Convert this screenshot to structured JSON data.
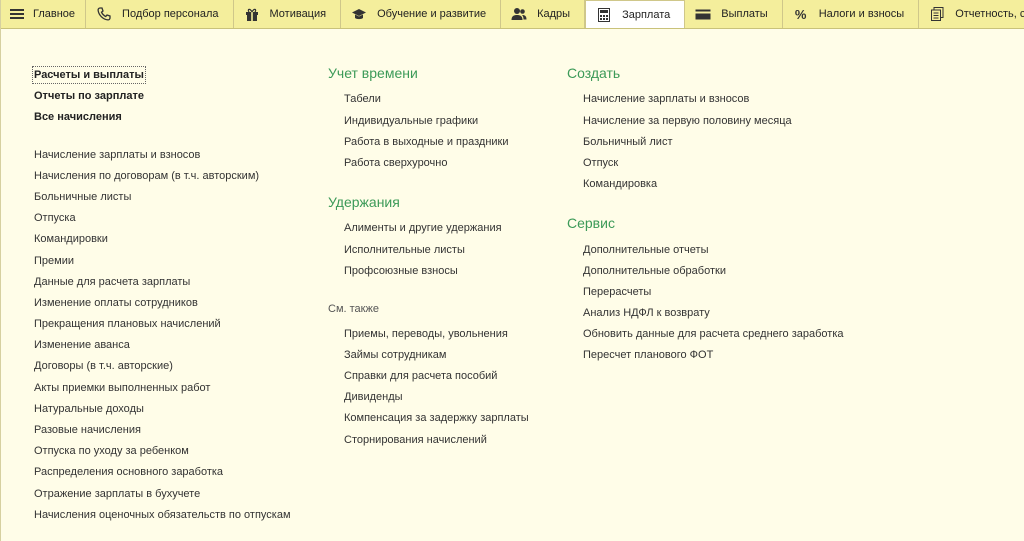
{
  "topbar": {
    "tabs": [
      {
        "label": "Главное",
        "icon": "menu-icon"
      },
      {
        "label": "Подбор персонала",
        "icon": "phone-icon"
      },
      {
        "label": "Мотивация",
        "icon": "gift-icon"
      },
      {
        "label": "Обучение и развитие",
        "icon": "graduation-cap-icon"
      },
      {
        "label": "Кадры",
        "icon": "users-icon"
      },
      {
        "label": "Зарплата",
        "icon": "calculator-icon",
        "active": true
      },
      {
        "label": "Выплаты",
        "icon": "wallet-icon"
      },
      {
        "label": "Налоги и взносы",
        "icon": "percent-icon"
      },
      {
        "label": "Отчетность, справки",
        "icon": "documents-icon"
      }
    ]
  },
  "left": {
    "top_links": [
      "Расчеты и выплаты",
      "Отчеты по зарплате",
      "Все начисления"
    ],
    "links": [
      "Начисление зарплаты и взносов",
      "Начисления по договорам (в т.ч. авторским)",
      "Больничные листы",
      "Отпуска",
      "Командировки",
      "Премии",
      "Данные для расчета зарплаты",
      "Изменение оплаты сотрудников",
      "Прекращения плановых начислений",
      "Изменение аванса",
      "Договоры (в т.ч. авторские)",
      "Акты приемки выполненных работ",
      "Натуральные доходы",
      "Разовые начисления",
      "Отпуска по уходу за ребенком",
      "Распределения основного заработка",
      "Отражение зарплаты в бухучете",
      "Начисления оценочных обязательств по отпускам"
    ]
  },
  "middle": {
    "time": {
      "title": "Учет времени",
      "items": [
        "Табели",
        "Индивидуальные графики",
        "Работа в выходные и праздники",
        "Работа сверхурочно"
      ]
    },
    "deductions": {
      "title": "Удержания",
      "items": [
        "Алименты и другие удержания",
        "Исполнительные листы",
        "Профсоюзные взносы"
      ]
    },
    "see_also": {
      "title": "См. также",
      "items": [
        "Приемы, переводы, увольнения",
        "Займы сотрудникам",
        "Справки для расчета пособий",
        "Дивиденды",
        "Компенсация за задержку зарплаты",
        "Сторнирования начислений"
      ]
    }
  },
  "right": {
    "create": {
      "title": "Создать",
      "items": [
        "Начисление зарплаты и взносов",
        "Начисление за первую половину месяца",
        "Больничный лист",
        "Отпуск",
        "Командировка"
      ]
    },
    "service": {
      "title": "Сервис",
      "items": [
        "Дополнительные отчеты",
        "Дополнительные обработки",
        "Перерасчеты",
        "Анализ НДФЛ к возврату",
        "Обновить данные для расчета среднего заработка",
        "Пересчет планового ФОТ"
      ]
    }
  },
  "colors": {
    "topbar_bg": "#f4ee9c",
    "page_bg": "#fffde8",
    "group_title": "#3c9a58"
  }
}
